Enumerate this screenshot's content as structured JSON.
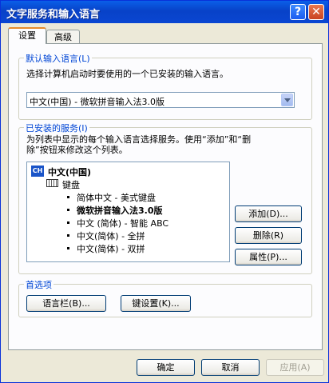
{
  "window": {
    "title": "文字服务和输入语言",
    "help_label": "?",
    "close_label": "✕"
  },
  "tabs": [
    {
      "label": "设置",
      "active": true
    },
    {
      "label": "高级",
      "active": false
    }
  ],
  "default_language": {
    "legend": "默认输入语言(L)",
    "description": "选择计算机启动时要使用的一个已安装的输入语言。",
    "selected": "中文(中国) - 微软拼音输入法3.0版"
  },
  "installed_services": {
    "legend": "已安装的服务(I)",
    "description_line1": "为列表中显示的每个输入语言选择服务。使用“添加”和“删",
    "description_line2": "除”按钮来修改这个列表。",
    "language_badge": "CH",
    "language": "中文(中国)",
    "category": "键盘",
    "items": [
      {
        "label": "简体中文 - 美式键盘",
        "selected": false
      },
      {
        "label": "微软拼音输入法3.0版",
        "selected": true
      },
      {
        "label": "中文 (简体) - 智能 ABC",
        "selected": false
      },
      {
        "label": "中文(简体) - 全拼",
        "selected": false
      },
      {
        "label": "中文(简体) - 双拼",
        "selected": false
      }
    ],
    "add_label": "添加(D)...",
    "remove_label": "删除(R)",
    "properties_label": "属性(P)..."
  },
  "preferences": {
    "legend": "首选项",
    "language_bar_label": "语言栏(B)...",
    "key_settings_label": "键设置(K)..."
  },
  "footer": {
    "ok_label": "确定",
    "cancel_label": "取消",
    "apply_label": "应用(A)",
    "apply_enabled": false
  },
  "colors": {
    "titlebar": "#0842c8",
    "group_legend": "#0046d5",
    "tab_highlight": "#e68b2c"
  }
}
